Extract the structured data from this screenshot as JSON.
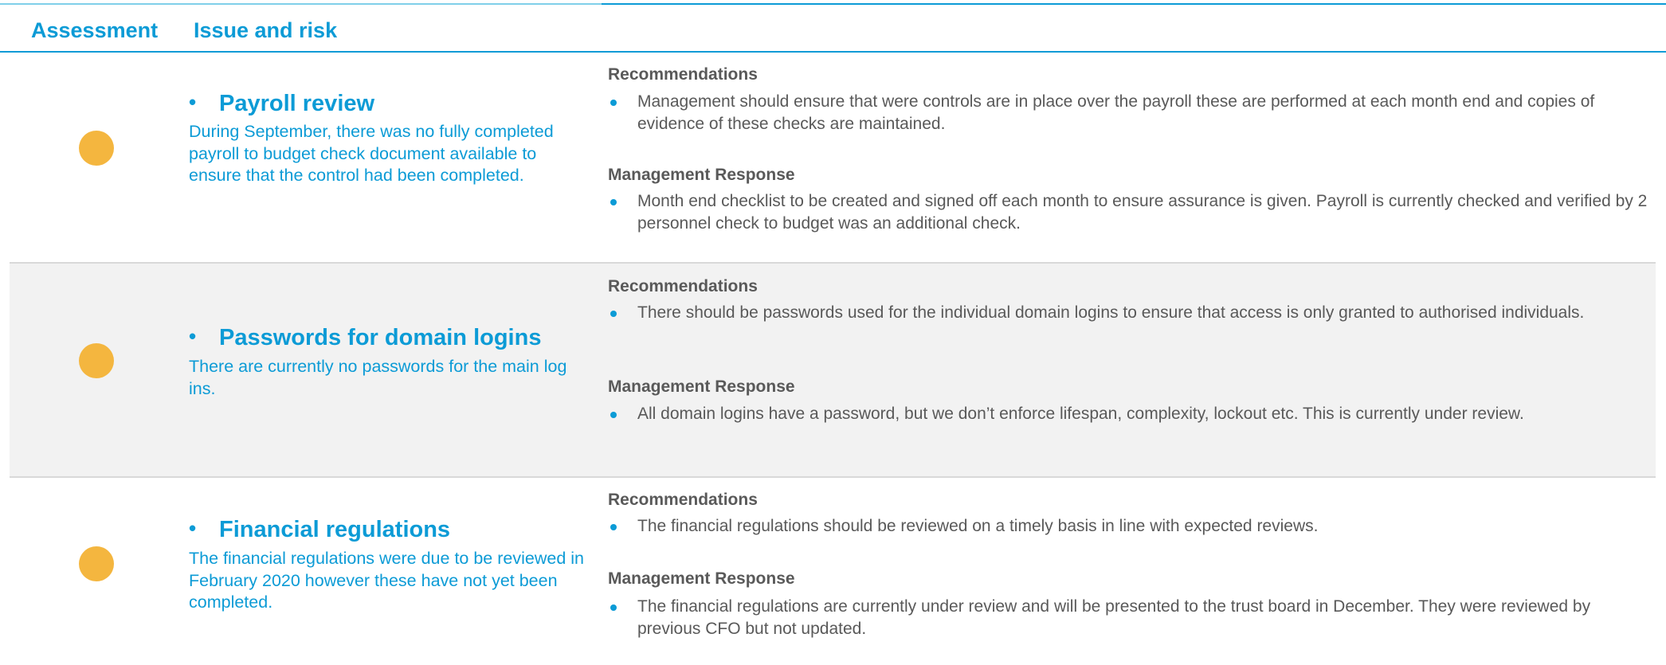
{
  "header": {
    "assessment_label": "Assessment",
    "issue_label": "Issue and risk"
  },
  "colors": {
    "accent": "#0c9bd6",
    "rating_amber": "#f4b63f",
    "body_text": "#595959",
    "row_shade": "#f2f2f2"
  },
  "rows": [
    {
      "rating": "amber",
      "title": "Payroll review",
      "description": "During September, there was no fully completed payroll to budget check document available to ensure that the control had been completed.",
      "recommendations_label": "Recommendations",
      "recommendation": "Management should ensure that were controls are in place over the payroll these are performed at each month end and copies of evidence of these checks are maintained.",
      "response_label": "Management Response",
      "response": "Month end checklist to be created and signed off each month to ensure assurance is given. Payroll is currently checked and verified by 2 personnel check to budget was an additional check."
    },
    {
      "rating": "amber",
      "title": "Passwords for domain logins",
      "description": "There are currently no passwords for the main log ins.",
      "recommendations_label": "Recommendations",
      "recommendation": "There should be passwords used for the individual domain logins to ensure that access is only granted to authorised individuals.",
      "response_label": "Management Response",
      "response": "All domain logins have a password, but we don’t enforce lifespan, complexity, lockout etc. This is currently under review."
    },
    {
      "rating": "amber",
      "title": "Financial regulations",
      "description": "The financial regulations were due to be reviewed in February 2020 however these have not yet been completed.",
      "recommendations_label": "Recommendations",
      "recommendation": "The financial regulations should be reviewed on a timely basis in line with expected reviews.",
      "response_label": "Management Response",
      "response": "The financial regulations are currently under review and will be presented to the trust board in December. They were reviewed by previous CFO but not updated."
    }
  ]
}
